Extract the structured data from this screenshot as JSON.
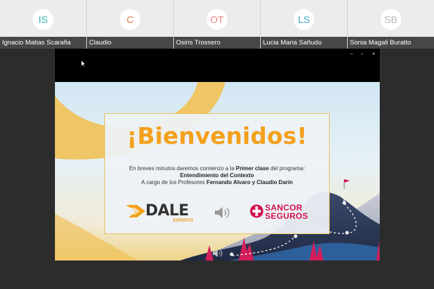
{
  "participants": [
    {
      "initials": "IS",
      "name": "Ignacio Matias Scarafia",
      "color": "#2bb3b3"
    },
    {
      "initials": "C",
      "name": "Claudio",
      "color": "#e07a4f"
    },
    {
      "initials": "OT",
      "name": "Osiris Trossero",
      "color": "#e4857f"
    },
    {
      "initials": "LS",
      "name": "Lucia Maria Sañudo",
      "color": "#3ba3c7"
    },
    {
      "initials": "SB",
      "name": "Sonia Magali Buratto",
      "color": "#b5b5b5"
    }
  ],
  "window_controls": {
    "minimize": "–",
    "restore": "▫",
    "close": "×"
  },
  "slide": {
    "headline": "¡Bienvenidos!",
    "intro_before": "En breves minutos daremos comienzo a la ",
    "intro_bold": "Primer clase",
    "intro_after": " del programa:",
    "course": "Entendimiento del Contexto",
    "teachers_before": "A cargo de los Profesores ",
    "teachers_bold": "Fernando Alvaro y Claudio Darin",
    "logo_dale": "DALE",
    "logo_dale_sub": "EXPERTO",
    "logo_sancor_1": "SANCOR",
    "logo_sancor_2": "SEGUROS"
  },
  "colors": {
    "accent_orange": "#f3a01c",
    "sancor_red": "#d1114c",
    "tile_label_bg": "#474747"
  }
}
